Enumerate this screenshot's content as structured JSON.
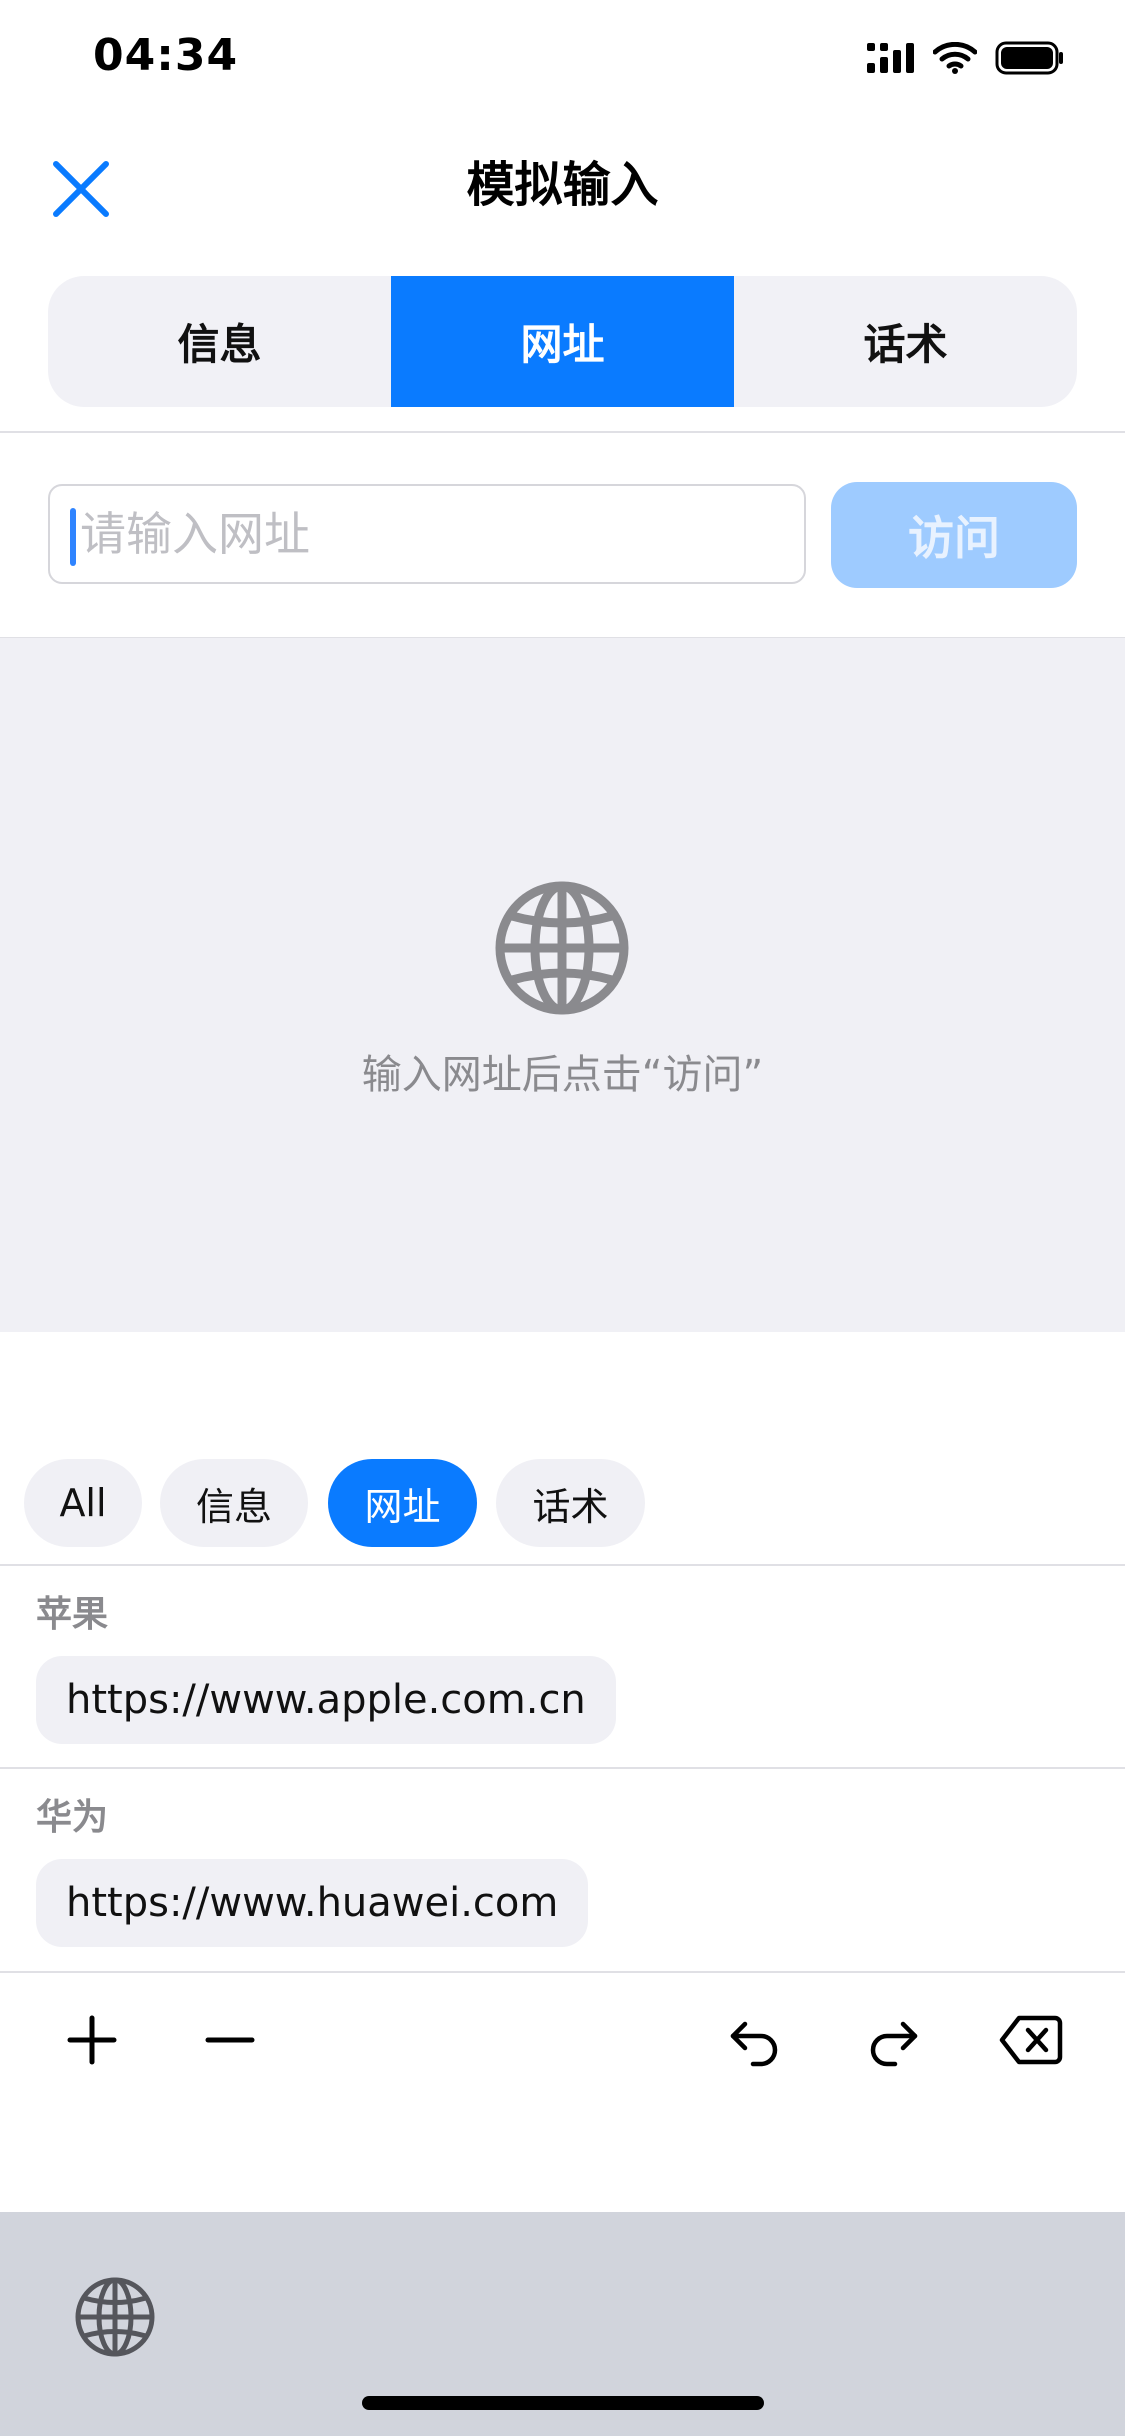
{
  "status_bar": {
    "time": "04:34"
  },
  "nav": {
    "title": "模拟输入"
  },
  "segments": [
    {
      "label": "信息",
      "active": false
    },
    {
      "label": "网址",
      "active": true
    },
    {
      "label": "话术",
      "active": false
    }
  ],
  "url_input": {
    "placeholder": "请输入网址",
    "value": ""
  },
  "visit_button": {
    "label": "访问",
    "enabled": false
  },
  "web_view": {
    "hint": "输入网址后点击“访问”"
  },
  "filter_chips": [
    {
      "label": "All",
      "active": false
    },
    {
      "label": "信息",
      "active": false
    },
    {
      "label": "网址",
      "active": true
    },
    {
      "label": "话术",
      "active": false
    }
  ],
  "entries": [
    {
      "title": "苹果",
      "url": "https://www.apple.com.cn"
    },
    {
      "title": "华为",
      "url": "https://www.huawei.com"
    }
  ],
  "toolbar": {
    "icons": [
      "plus-icon",
      "minus-icon",
      "undo-icon",
      "redo-icon",
      "delete-backward-icon"
    ]
  },
  "colors": {
    "accent": "#0a7bff",
    "accent_disabled": "#9ecbff",
    "surface": "#f0f0f5",
    "keyboard_bg": "#d1d4dc"
  }
}
